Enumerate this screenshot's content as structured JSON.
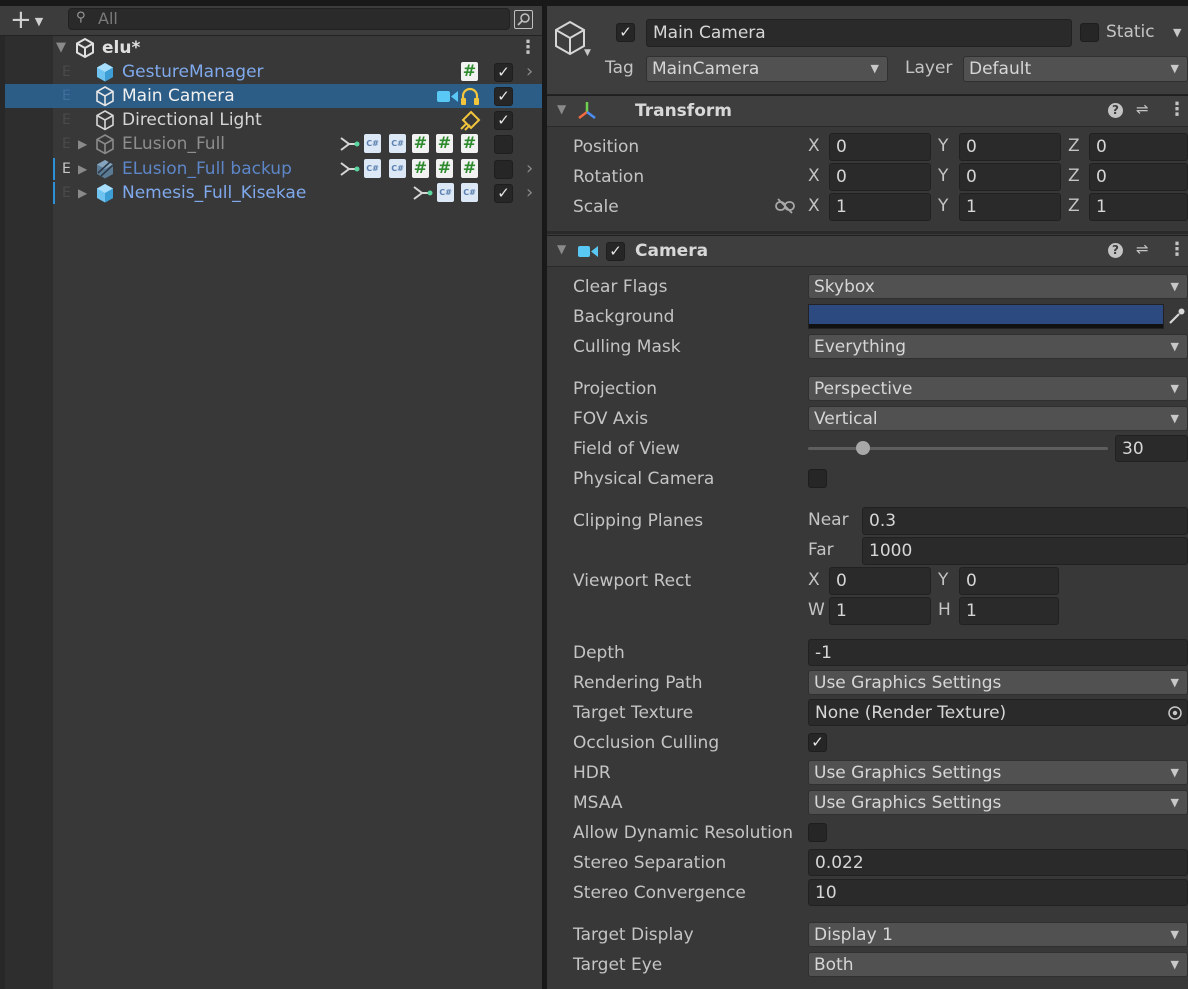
{
  "hierarchy": {
    "search_placeholder": "All",
    "scene": {
      "name": "elu*"
    },
    "rows": [
      {
        "name": "GestureManager",
        "color": "blue",
        "checked": true
      },
      {
        "name": "Main Camera",
        "color": "light",
        "checked": true,
        "selected": true
      },
      {
        "name": "Directional Light",
        "color": "light",
        "checked": true
      },
      {
        "name": "ELusion_Full",
        "color": "grey",
        "checked": false
      },
      {
        "name": "ELusion_Full backup",
        "color": "blue",
        "checked": false
      },
      {
        "name": "Nemesis_Full_Kisekae",
        "color": "blue",
        "checked": true
      }
    ],
    "row_prefix": "E"
  },
  "inspector": {
    "object_name": "Main Camera",
    "static_label": "Static",
    "tag_label": "Tag",
    "tag_value": "MainCamera",
    "layer_label": "Layer",
    "layer_value": "Default",
    "transform": {
      "title": "Transform",
      "position": {
        "label": "Position",
        "x": "0",
        "y": "0",
        "z": "0"
      },
      "rotation": {
        "label": "Rotation",
        "x": "0",
        "y": "0",
        "z": "0"
      },
      "scale": {
        "label": "Scale",
        "x": "1",
        "y": "1",
        "z": "1"
      },
      "axis_x": "X",
      "axis_y": "Y",
      "axis_z": "Z"
    },
    "camera": {
      "title": "Camera",
      "clear_flags": {
        "label": "Clear Flags",
        "value": "Skybox"
      },
      "background": {
        "label": "Background",
        "color": "#2d4a80"
      },
      "culling_mask": {
        "label": "Culling Mask",
        "value": "Everything"
      },
      "projection": {
        "label": "Projection",
        "value": "Perspective"
      },
      "fov_axis": {
        "label": "FOV Axis",
        "value": "Vertical"
      },
      "field_of_view": {
        "label": "Field of View",
        "value": "30"
      },
      "physical_camera": {
        "label": "Physical Camera",
        "checked": false
      },
      "clipping_planes": {
        "label": "Clipping Planes",
        "near_label": "Near",
        "near": "0.3",
        "far_label": "Far",
        "far": "1000"
      },
      "viewport_rect": {
        "label": "Viewport Rect",
        "x_label": "X",
        "x": "0",
        "y_label": "Y",
        "y": "0",
        "w_label": "W",
        "w": "1",
        "h_label": "H",
        "h": "1"
      },
      "depth": {
        "label": "Depth",
        "value": "-1"
      },
      "rendering_path": {
        "label": "Rendering Path",
        "value": "Use Graphics Settings"
      },
      "target_texture": {
        "label": "Target Texture",
        "value": "None (Render Texture)"
      },
      "occlusion_culling": {
        "label": "Occlusion Culling",
        "checked": true
      },
      "hdr": {
        "label": "HDR",
        "value": "Use Graphics Settings"
      },
      "msaa": {
        "label": "MSAA",
        "value": "Use Graphics Settings"
      },
      "allow_dynamic_resolution": {
        "label": "Allow Dynamic Resolution",
        "checked": false
      },
      "stereo_separation": {
        "label": "Stereo Separation",
        "value": "0.022"
      },
      "stereo_convergence": {
        "label": "Stereo Convergence",
        "value": "10"
      },
      "target_display": {
        "label": "Target Display",
        "value": "Display 1"
      },
      "target_eye": {
        "label": "Target Eye",
        "value": "Both"
      }
    }
  },
  "colors": {
    "selection": "#2c5d87",
    "prefab_blue": "#7fa9ec",
    "panel": "#383838"
  }
}
